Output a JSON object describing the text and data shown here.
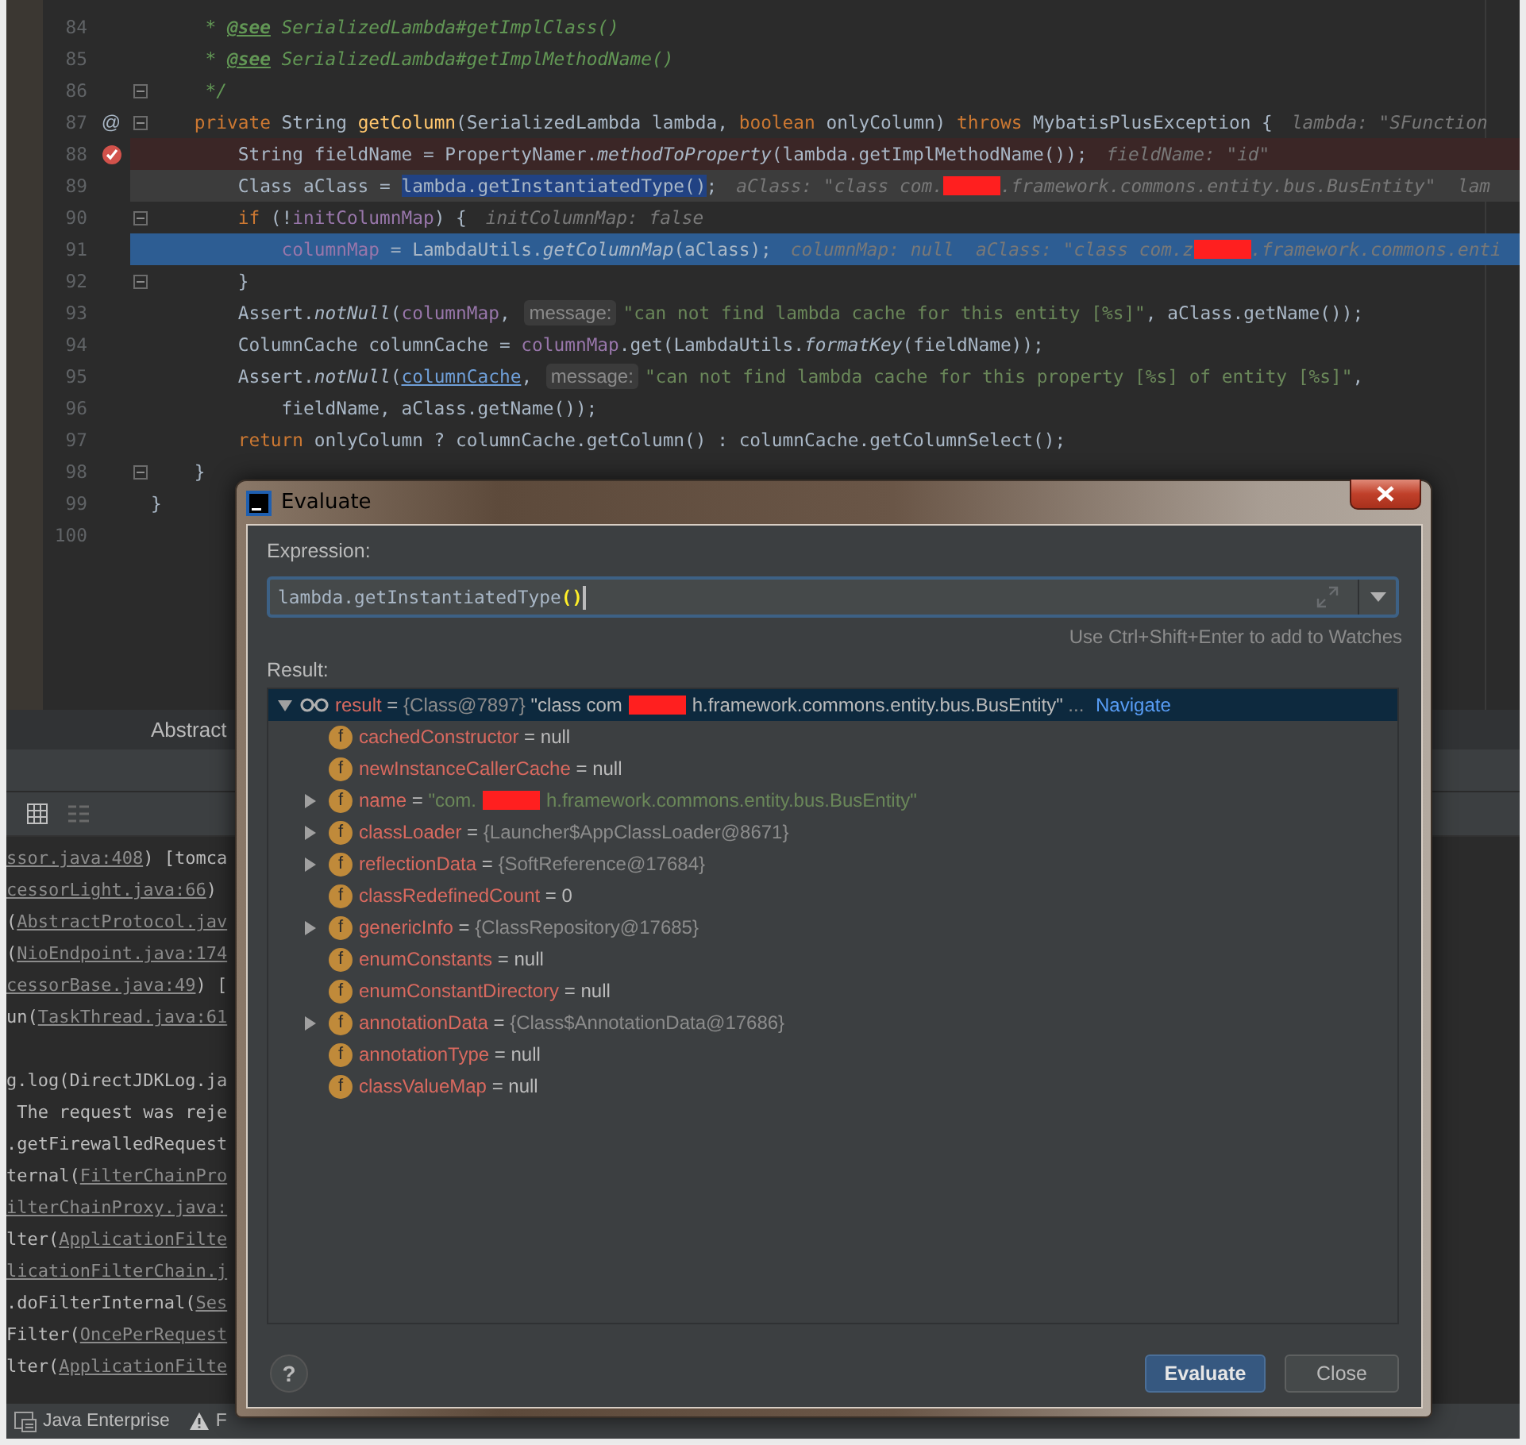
{
  "editor": {
    "lines": [
      {
        "number": "84",
        "breakpoint": false,
        "current": false,
        "executing": false,
        "fold": false,
        "segments": [
          {
            "kind": "doc",
            "text": "     * "
          },
          {
            "kind": "doc-tag",
            "text": "@see"
          },
          {
            "kind": "doc",
            "text": " SerializedLambda#getImplClass()"
          }
        ]
      },
      {
        "number": "85",
        "breakpoint": false,
        "current": false,
        "executing": false,
        "fold": false,
        "segments": [
          {
            "kind": "doc",
            "text": "     * "
          },
          {
            "kind": "doc-tag",
            "text": "@see"
          },
          {
            "kind": "doc",
            "text": " SerializedLambda#getImplMethodName()"
          }
        ]
      },
      {
        "number": "86",
        "breakpoint": false,
        "current": false,
        "executing": false,
        "fold": true,
        "segments": [
          {
            "kind": "doc",
            "text": "     */"
          }
        ]
      },
      {
        "number": "87",
        "gutter_text": "@",
        "breakpoint": false,
        "current": false,
        "executing": false,
        "fold": true,
        "segments": [
          {
            "kind": "keyword",
            "text": "    private"
          },
          {
            "kind": "plain",
            "text": " String "
          },
          {
            "kind": "decl",
            "text": "getColumn"
          },
          {
            "kind": "plain",
            "text": "(SerializedLambda lambda, "
          },
          {
            "kind": "keyword",
            "text": "boolean"
          },
          {
            "kind": "plain",
            "text": " onlyColumn) "
          },
          {
            "kind": "keyword",
            "text": "throws"
          },
          {
            "kind": "plain",
            "text": " MybatisPlusException {"
          },
          {
            "kind": "hint",
            "text": "lambda: \"SFunction"
          }
        ]
      },
      {
        "number": "88",
        "breakpoint": true,
        "current": false,
        "executing": false,
        "fold": false,
        "segments": [
          {
            "kind": "plain",
            "text": "        String fieldName = PropertyNamer."
          },
          {
            "kind": "italic",
            "text": "methodToProperty"
          },
          {
            "kind": "plain",
            "text": "(lambda.getImplMethodName());"
          },
          {
            "kind": "hint",
            "text": "fieldName: \"id\""
          }
        ]
      },
      {
        "number": "89",
        "breakpoint": false,
        "current": true,
        "executing": false,
        "fold": false,
        "segments": [
          {
            "kind": "plain",
            "text": "        Class aClass = "
          },
          {
            "kind": "selection",
            "text": "lambda.getInstantiatedType()"
          },
          {
            "kind": "plain",
            "text": ";"
          },
          {
            "kind": "hint",
            "text": "aClass: \"class com."
          },
          {
            "kind": "redacted"
          },
          {
            "kind": "hint",
            "text": ".framework.commons.entity.bus.BusEntity\"  lam"
          }
        ]
      },
      {
        "number": "90",
        "breakpoint": false,
        "current": false,
        "executing": false,
        "fold": true,
        "segments": [
          {
            "kind": "keyword",
            "text": "        if"
          },
          {
            "kind": "plain",
            "text": " (!"
          },
          {
            "kind": "field",
            "text": "initColumnMap"
          },
          {
            "kind": "plain",
            "text": ") {"
          },
          {
            "kind": "hint",
            "text": "initColumnMap: false"
          }
        ]
      },
      {
        "number": "91",
        "breakpoint": false,
        "current": false,
        "executing": true,
        "fold": false,
        "segments": [
          {
            "kind": "field",
            "text": "            columnMap"
          },
          {
            "kind": "plain",
            "text": " = LambdaUtils."
          },
          {
            "kind": "italic",
            "text": "getColumnMap"
          },
          {
            "kind": "plain",
            "text": "(aClass);"
          },
          {
            "kind": "hint",
            "text": "columnMap: null  aClass: \"class com.z"
          },
          {
            "kind": "redacted"
          },
          {
            "kind": "hint",
            "text": ".framework.commons.enti"
          }
        ]
      },
      {
        "number": "92",
        "breakpoint": false,
        "current": false,
        "executing": false,
        "fold": true,
        "segments": [
          {
            "kind": "plain",
            "text": "        }"
          }
        ]
      },
      {
        "number": "93",
        "breakpoint": false,
        "current": false,
        "executing": false,
        "fold": false,
        "segments": [
          {
            "kind": "plain",
            "text": "        Assert."
          },
          {
            "kind": "italic",
            "text": "notNull"
          },
          {
            "kind": "plain",
            "text": "("
          },
          {
            "kind": "field",
            "text": "columnMap"
          },
          {
            "kind": "plain",
            "text": ", "
          },
          {
            "kind": "chip",
            "text": "message:"
          },
          {
            "kind": "string",
            "text": "\"can not find lambda cache for this entity [%s]\""
          },
          {
            "kind": "plain",
            "text": ", aClass.getName());"
          }
        ]
      },
      {
        "number": "94",
        "breakpoint": false,
        "current": false,
        "executing": false,
        "fold": false,
        "segments": [
          {
            "kind": "plain",
            "text": "        ColumnCache columnCache = "
          },
          {
            "kind": "field",
            "text": "columnMap"
          },
          {
            "kind": "plain",
            "text": ".get(LambdaUtils."
          },
          {
            "kind": "italic",
            "text": "formatKey"
          },
          {
            "kind": "plain",
            "text": "(fieldName));"
          }
        ]
      },
      {
        "number": "95",
        "breakpoint": false,
        "current": false,
        "executing": false,
        "fold": false,
        "segments": [
          {
            "kind": "plain",
            "text": "        Assert."
          },
          {
            "kind": "italic",
            "text": "notNull"
          },
          {
            "kind": "plain",
            "text": "("
          },
          {
            "kind": "underline",
            "text": "columnCache"
          },
          {
            "kind": "plain",
            "text": ", "
          },
          {
            "kind": "chip",
            "text": "message:"
          },
          {
            "kind": "string",
            "text": "\"can not find lambda cache for this property [%s] of entity [%s]\""
          },
          {
            "kind": "plain",
            "text": ","
          }
        ]
      },
      {
        "number": "96",
        "breakpoint": false,
        "current": false,
        "executing": false,
        "fold": false,
        "segments": [
          {
            "kind": "plain",
            "text": "            fieldName, aClass.getName());"
          }
        ]
      },
      {
        "number": "97",
        "breakpoint": false,
        "current": false,
        "executing": false,
        "fold": false,
        "segments": [
          {
            "kind": "keyword",
            "text": "        return"
          },
          {
            "kind": "plain",
            "text": " onlyColumn ? columnCache.getColumn() : columnCache.getColumnSelect();"
          }
        ]
      },
      {
        "number": "98",
        "breakpoint": false,
        "current": false,
        "executing": false,
        "fold": true,
        "segments": [
          {
            "kind": "plain",
            "text": "    }"
          }
        ]
      },
      {
        "number": "99",
        "breakpoint": false,
        "current": false,
        "executing": false,
        "fold": false,
        "segments": [
          {
            "kind": "plain",
            "text": "}"
          }
        ]
      },
      {
        "number": "100",
        "breakpoint": false,
        "current": false,
        "executing": false,
        "fold": false
      }
    ]
  },
  "editor_tab": {
    "label": "Abstract"
  },
  "console": {
    "blocks": [
      {
        "lines": [
          {
            "segments": [
              {
                "kind": "link",
                "text": "ssor.java:408"
              },
              {
                "kind": "plain",
                "text": ") [tomca"
              }
            ]
          },
          {
            "segments": [
              {
                "kind": "link",
                "text": "cessorLight.java:66"
              },
              {
                "kind": "plain",
                "text": ")"
              }
            ]
          },
          {
            "segments": [
              {
                "kind": "plain",
                "text": "("
              },
              {
                "kind": "link",
                "text": "AbstractProtocol.jav"
              }
            ]
          },
          {
            "segments": [
              {
                "kind": "plain",
                "text": "("
              },
              {
                "kind": "link",
                "text": "NioEndpoint.java:174"
              }
            ]
          },
          {
            "segments": [
              {
                "kind": "link",
                "text": "cessorBase.java:49"
              },
              {
                "kind": "plain",
                "text": ") ["
              }
            ]
          },
          {
            "segments": [
              {
                "kind": "plain",
                "text": "un("
              },
              {
                "kind": "link",
                "text": "TaskThread.java:61"
              }
            ]
          }
        ]
      },
      {
        "lines": [
          {
            "segments": [
              {
                "kind": "plain",
                "text": "g.log(DirectJDKLog.ja"
              }
            ]
          },
          {
            "segments": [
              {
                "kind": "plain",
                "text": " The request was reje"
              }
            ]
          },
          {
            "segments": [
              {
                "kind": "plain",
                "text": ".getFirewalledRequest"
              }
            ]
          },
          {
            "segments": [
              {
                "kind": "plain",
                "text": "ternal("
              },
              {
                "kind": "link",
                "text": "FilterChainPro"
              }
            ]
          },
          {
            "segments": [
              {
                "kind": "link",
                "text": "ilterChainProxy.java:"
              }
            ]
          },
          {
            "segments": [
              {
                "kind": "plain",
                "text": "lter("
              },
              {
                "kind": "link",
                "text": "ApplicationFilte"
              }
            ]
          },
          {
            "segments": [
              {
                "kind": "link",
                "text": "licationFilterChain.j"
              }
            ]
          },
          {
            "segments": [
              {
                "kind": "plain",
                "text": ".doFilterInternal("
              },
              {
                "kind": "link",
                "text": "Ses"
              }
            ]
          },
          {
            "segments": [
              {
                "kind": "plain",
                "text": "Filter("
              },
              {
                "kind": "link",
                "text": "OncePerRequest"
              }
            ]
          },
          {
            "segments": [
              {
                "kind": "plain",
                "text": "lter("
              },
              {
                "kind": "link",
                "text": "ApplicationFilte"
              }
            ]
          }
        ]
      }
    ]
  },
  "status_bar": {
    "items": [
      {
        "kind": "tool-window",
        "label": "Java Enterprise"
      },
      {
        "kind": "warning",
        "label": "F"
      }
    ]
  },
  "dialog": {
    "title": "Evaluate",
    "expression": {
      "label": "Expression:",
      "value": [
        {
          "kind": "plain",
          "text": "lambda.getInstantiatedType"
        },
        {
          "kind": "brace-match",
          "text": "()"
        }
      ],
      "hint": "Use Ctrl+Shift+Enter to add to Watches"
    },
    "result": {
      "label": "Result:",
      "tree": [
        {
          "kind": "watch",
          "expandable": true,
          "expanded": true,
          "selected": true,
          "label": [
            {
              "kind": "name",
              "text": "result"
            },
            {
              "kind": "value",
              "text": " = "
            },
            {
              "kind": "ref",
              "text": "{Class@7897} "
            },
            {
              "kind": "value",
              "text": "\"class com"
            },
            {
              "kind": "redacted"
            },
            {
              "kind": "value",
              "text": "h.framework.commons.entity.bus.BusEntity\" "
            },
            {
              "kind": "ref",
              "text": "... "
            },
            {
              "kind": "link",
              "text": "Navigate"
            }
          ],
          "children": [
            {
              "kind": "field",
              "badge": "f",
              "expandable": false,
              "selected": false,
              "label": [
                {
                  "kind": "name",
                  "text": "cachedConstructor"
                },
                {
                  "kind": "value",
                  "text": " = null"
                }
              ]
            },
            {
              "kind": "field",
              "badge": "f",
              "expandable": false,
              "selected": false,
              "label": [
                {
                  "kind": "name",
                  "text": "newInstanceCallerCache"
                },
                {
                  "kind": "value",
                  "text": " = null"
                }
              ]
            },
            {
              "kind": "field",
              "badge": "f",
              "expandable": true,
              "expanded": false,
              "selected": false,
              "label": [
                {
                  "kind": "name",
                  "text": "name"
                },
                {
                  "kind": "value",
                  "text": " = "
                },
                {
                  "kind": "string",
                  "text": "\"com."
                },
                {
                  "kind": "redacted"
                },
                {
                  "kind": "string",
                  "text": "h.framework.commons.entity.bus.BusEntity\""
                }
              ]
            },
            {
              "kind": "field",
              "badge": "f",
              "expandable": true,
              "expanded": false,
              "selected": false,
              "label": [
                {
                  "kind": "name",
                  "text": "classLoader"
                },
                {
                  "kind": "value",
                  "text": " = "
                },
                {
                  "kind": "ref",
                  "text": "{Launcher$AppClassLoader@8671}"
                }
              ]
            },
            {
              "kind": "field",
              "badge": "f",
              "expandable": true,
              "expanded": false,
              "selected": false,
              "label": [
                {
                  "kind": "name",
                  "text": "reflectionData"
                },
                {
                  "kind": "value",
                  "text": " = "
                },
                {
                  "kind": "ref",
                  "text": "{SoftReference@17684}"
                }
              ]
            },
            {
              "kind": "field",
              "badge": "f",
              "expandable": false,
              "selected": false,
              "label": [
                {
                  "kind": "name",
                  "text": "classRedefinedCount"
                },
                {
                  "kind": "value",
                  "text": " = 0"
                }
              ]
            },
            {
              "kind": "field",
              "badge": "f",
              "expandable": true,
              "expanded": false,
              "selected": false,
              "label": [
                {
                  "kind": "name",
                  "text": "genericInfo"
                },
                {
                  "kind": "value",
                  "text": " = "
                },
                {
                  "kind": "ref",
                  "text": "{ClassRepository@17685}"
                }
              ]
            },
            {
              "kind": "field",
              "badge": "f",
              "expandable": false,
              "selected": false,
              "label": [
                {
                  "kind": "name",
                  "text": "enumConstants"
                },
                {
                  "kind": "value",
                  "text": " = null"
                }
              ]
            },
            {
              "kind": "field",
              "badge": "f",
              "expandable": false,
              "selected": false,
              "label": [
                {
                  "kind": "name",
                  "text": "enumConstantDirectory"
                },
                {
                  "kind": "value",
                  "text": " = null"
                }
              ]
            },
            {
              "kind": "field",
              "badge": "f",
              "expandable": true,
              "expanded": false,
              "selected": false,
              "label": [
                {
                  "kind": "name",
                  "text": "annotationData"
                },
                {
                  "kind": "value",
                  "text": " = "
                },
                {
                  "kind": "ref",
                  "text": "{Class$AnnotationData@17686}"
                }
              ]
            },
            {
              "kind": "field",
              "badge": "f",
              "expandable": false,
              "selected": false,
              "label": [
                {
                  "kind": "name",
                  "text": "annotationType"
                },
                {
                  "kind": "value",
                  "text": " = null"
                }
              ]
            },
            {
              "kind": "field",
              "badge": "f",
              "expandable": false,
              "selected": false,
              "label": [
                {
                  "kind": "name",
                  "text": "classValueMap"
                },
                {
                  "kind": "value",
                  "text": " = null"
                }
              ]
            }
          ]
        }
      ]
    },
    "help": "?",
    "buttons": [
      {
        "label": "Evaluate",
        "default": true
      },
      {
        "label": "Close",
        "default": false
      }
    ]
  }
}
